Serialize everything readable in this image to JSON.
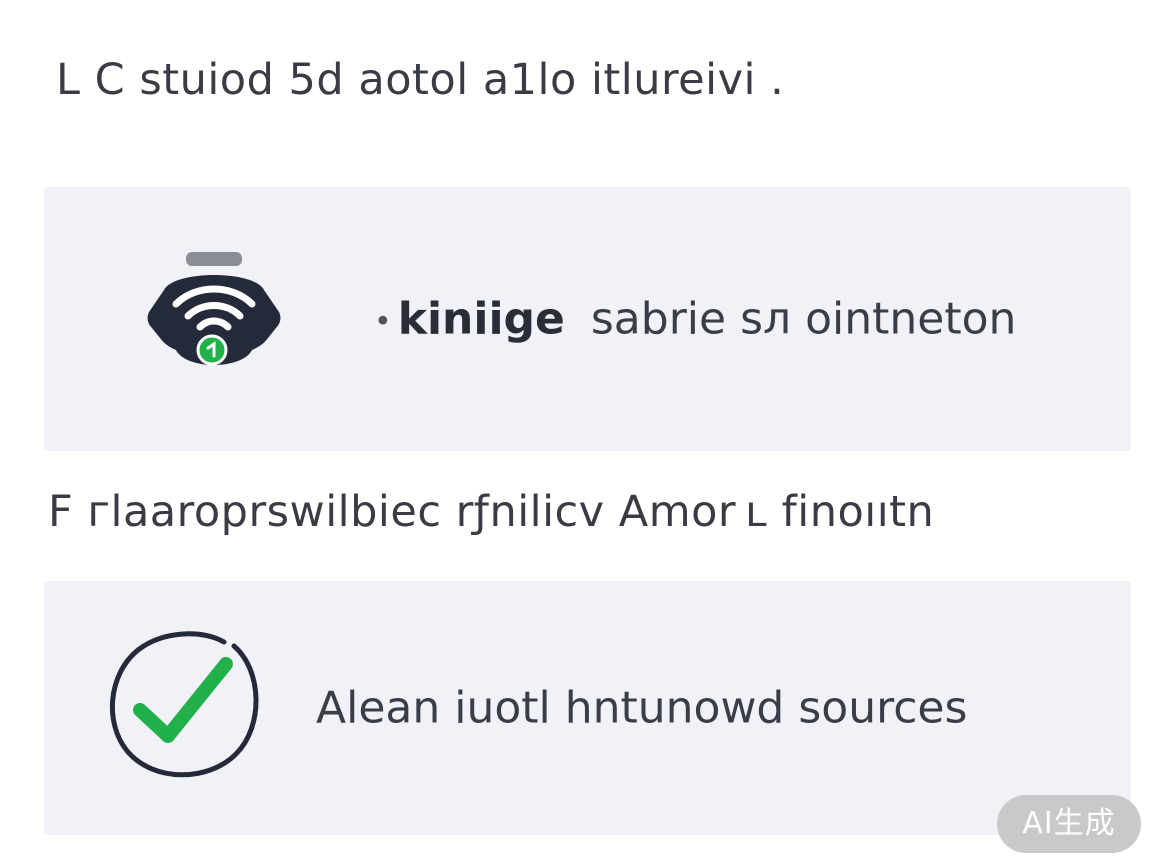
{
  "heading_1": "L C stuiod 5d aotol a1lo itlureivi .",
  "card_1": {
    "icon": "wifi-lock-icon",
    "lead_mark": "•",
    "title_bold": "kiniige",
    "text": "sabrie sл ointneton"
  },
  "heading_2": "F гlaaroprѕwilbiec rƒnilicv Amor ʟ finoııtn",
  "card_2": {
    "icon": "check-circle-icon",
    "text": "Alean iuotl hntunowd sources"
  },
  "badge": "AI生成",
  "colors": {
    "card_background": "#f1f1f8",
    "icon_dark": "#252a3a",
    "check_green": "#22b04a",
    "badge_background": "#c9c9cc"
  }
}
